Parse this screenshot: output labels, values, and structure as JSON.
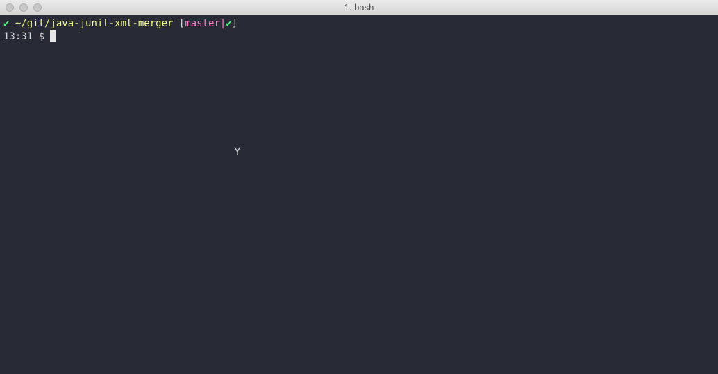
{
  "window": {
    "title": "1. bash"
  },
  "prompt": {
    "status_icon": "check-icon",
    "status_glyph": "✔",
    "path": "~/git/java-junit-xml-merger",
    "bracket_open": "[",
    "branch": "master",
    "separator": "|",
    "branch_status_glyph": "✔",
    "bracket_close": "]",
    "time": "13:31",
    "symbol": "$"
  },
  "colors": {
    "background": "#282a36",
    "check": "#50fa7b",
    "path": "#f1fa8c",
    "branch": "#ff79c6"
  },
  "mouse_cursor": {
    "icon": "i-beam-cursor-icon",
    "glyph": "Y"
  }
}
